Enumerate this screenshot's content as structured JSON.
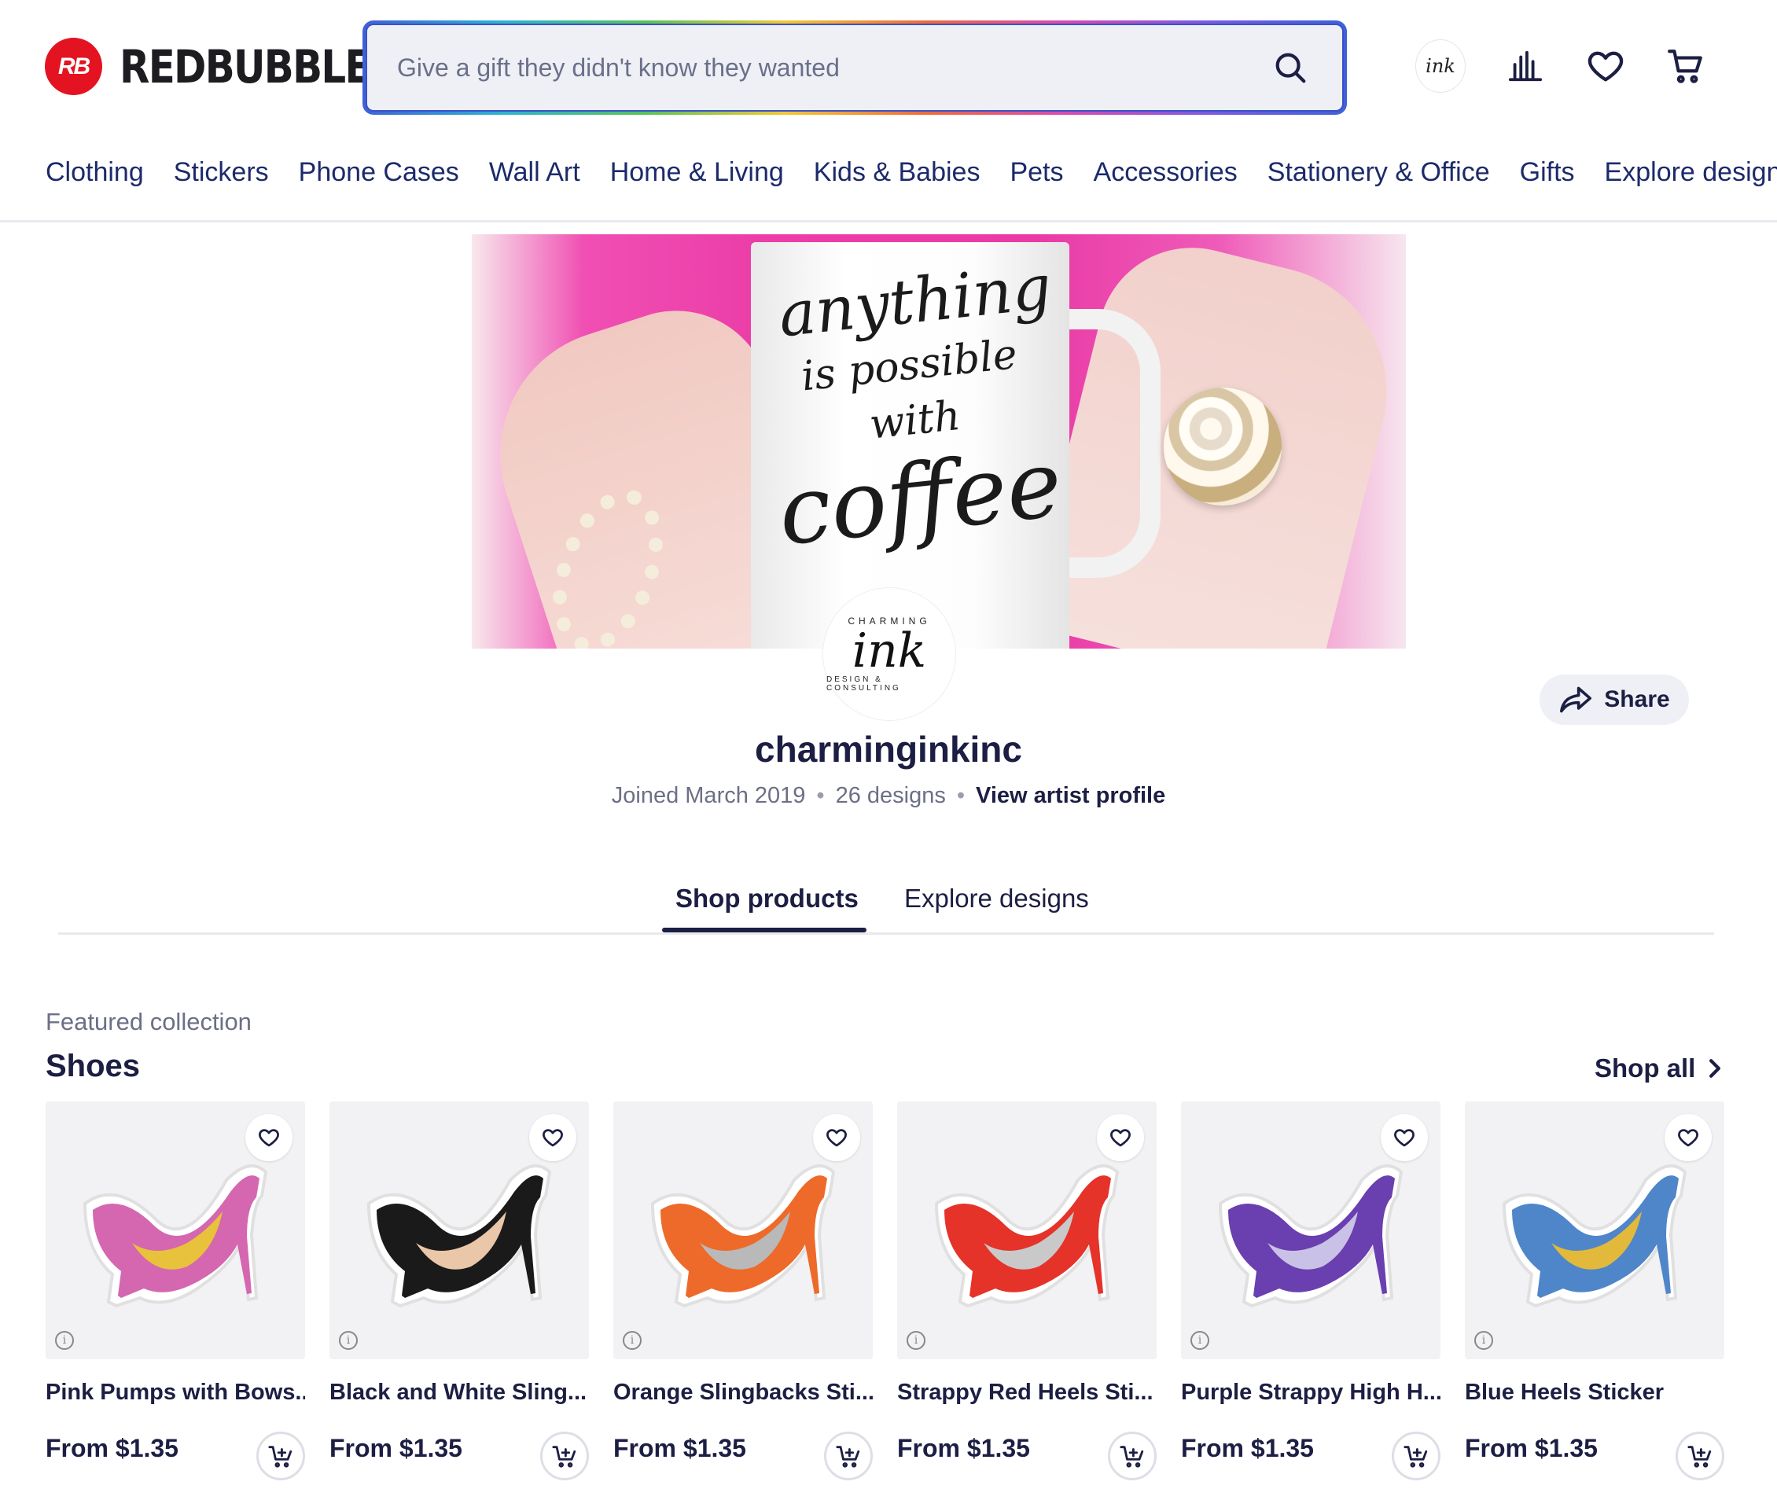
{
  "header": {
    "logo_mark": "RB",
    "logo_text": "REDBUBBLE",
    "search_placeholder": "Give a gift they didn't know they wanted",
    "avatar_text": "ink"
  },
  "nav": [
    "Clothing",
    "Stickers",
    "Phone Cases",
    "Wall Art",
    "Home & Living",
    "Kids & Babies",
    "Pets",
    "Accessories",
    "Stationery & Office",
    "Gifts",
    "Explore designs"
  ],
  "hero": {
    "mug_line1": "anything",
    "mug_line2": "is possible with",
    "mug_line3": "coffee"
  },
  "profile": {
    "avatar_top": "CHARMING",
    "avatar_main": "ink",
    "avatar_bottom": "DESIGN & CONSULTING",
    "name": "charminginkinc",
    "joined": "Joined March 2019",
    "designs": "26 designs",
    "view_profile": "View artist profile",
    "share": "Share"
  },
  "tabs": {
    "shop": "Shop products",
    "explore": "Explore designs"
  },
  "collection": {
    "subtitle": "Featured collection",
    "title": "Shoes",
    "shop_all": "Shop all",
    "items": [
      {
        "title": "Pink Pumps with Bows...",
        "price": "From $1.35",
        "color": "#d467b0",
        "accent": "#e8c23a"
      },
      {
        "title": "Black and White Sling...",
        "price": "From $1.35",
        "color": "#1a1a1a",
        "accent": "#e9c7a8"
      },
      {
        "title": "Orange Slingbacks Sti...",
        "price": "From $1.35",
        "color": "#ee6a2a",
        "accent": "#b9b9b9"
      },
      {
        "title": "Strappy Red Heels Sti...",
        "price": "From $1.35",
        "color": "#e5332a",
        "accent": "#c9c9c9"
      },
      {
        "title": "Purple Strappy High H...",
        "price": "From $1.35",
        "color": "#6a3fb0",
        "accent": "#c9c2e6"
      },
      {
        "title": "Blue Heels Sticker",
        "price": "From $1.35",
        "color": "#4f86c9",
        "accent": "#e3b93c"
      }
    ]
  }
}
